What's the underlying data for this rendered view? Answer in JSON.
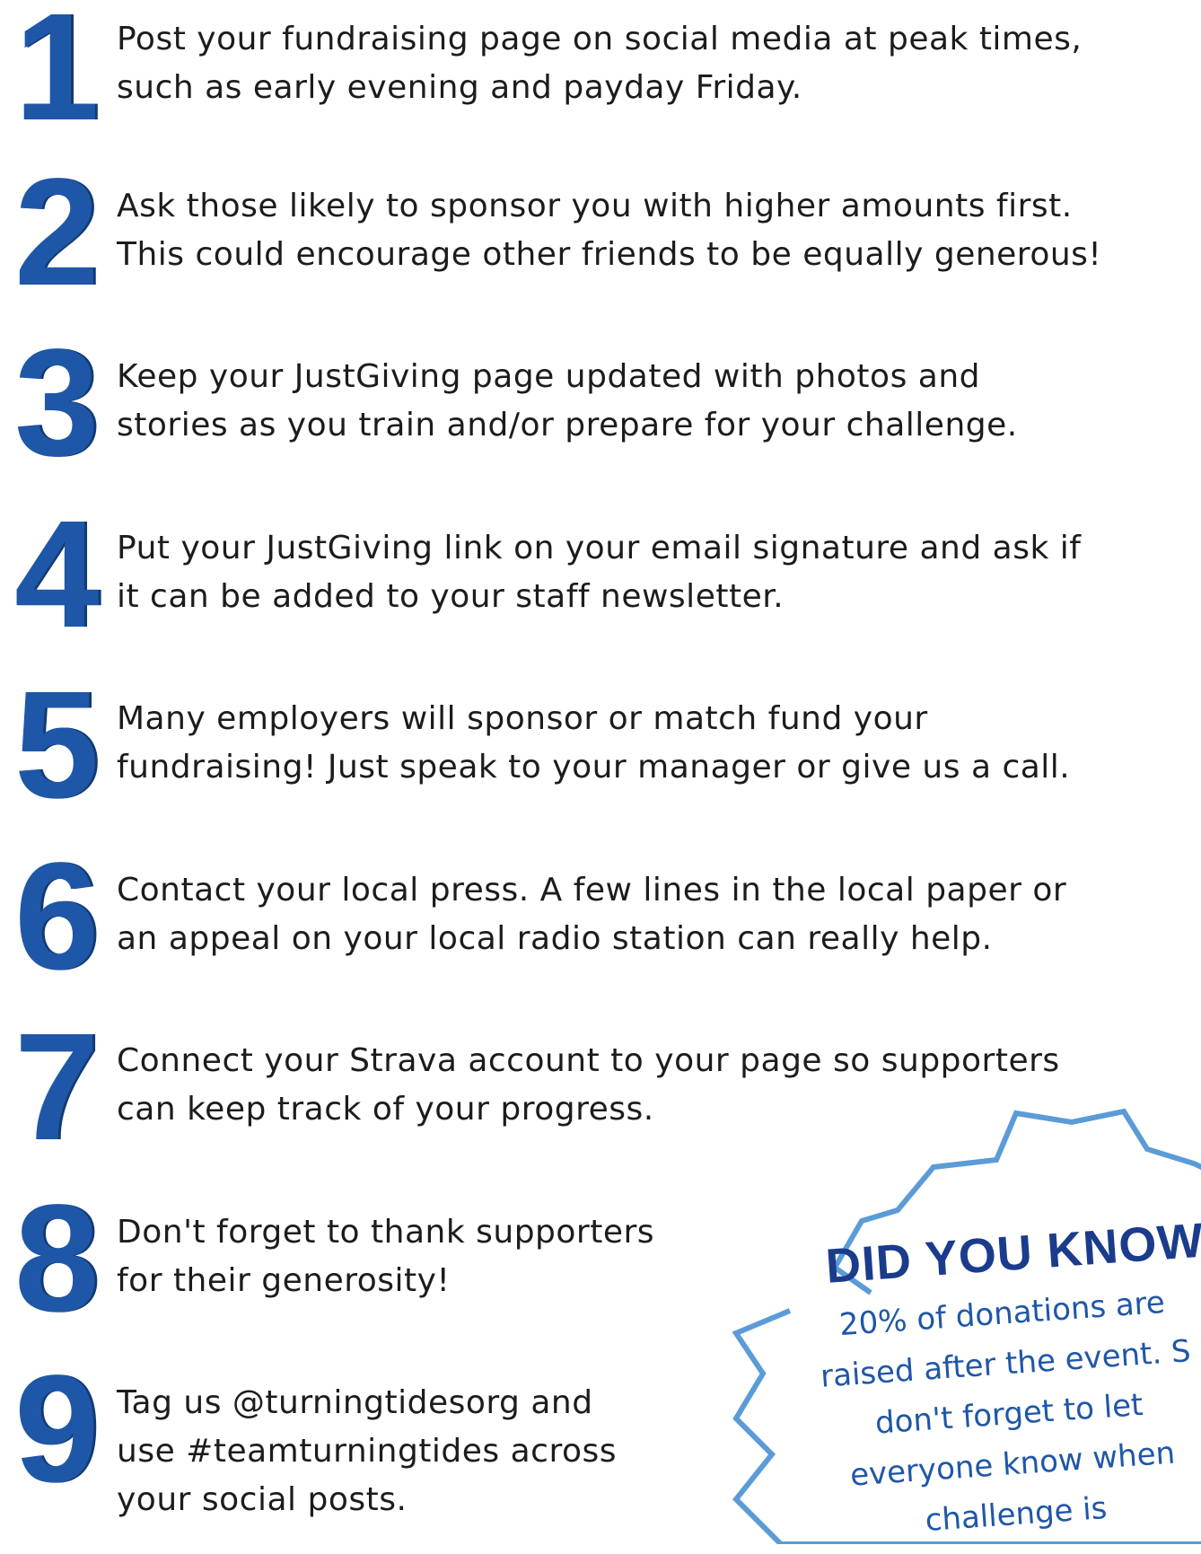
{
  "tips": [
    {
      "number": "1",
      "lines": [
        "Post your fundraising page on social media at peak times,",
        "such as early evening and payday Friday."
      ]
    },
    {
      "number": "2",
      "lines": [
        "Ask those likely to sponsor you with higher amounts first.",
        "This could encourage other friends to be equally generous!"
      ]
    },
    {
      "number": "3",
      "lines": [
        "Keep your JustGiving page updated with photos and",
        "stories as you train and/or prepare for your challenge."
      ]
    },
    {
      "number": "4",
      "lines": [
        "Put your JustGiving link on your email signature and ask if",
        "it can be added to your staff newsletter."
      ]
    },
    {
      "number": "5",
      "lines": [
        "Many employers will sponsor or match fund your",
        "fundraising! Just speak to your manager or give us a call."
      ]
    },
    {
      "number": "6",
      "lines": [
        "Contact your local press. A few lines in the local paper or",
        "an appeal on your local radio station can really help."
      ]
    },
    {
      "number": "7",
      "lines": [
        "Connect your Strava account to your page so supporters",
        "can keep track of your progress."
      ]
    },
    {
      "number": "8",
      "lines": [
        "Don't forget to thank supporters",
        "for their generosity!"
      ]
    },
    {
      "number": "9",
      "lines": [
        "Tag us @turningtidesorg and",
        "use #teamturningtides across",
        "your social posts."
      ]
    }
  ],
  "did_you_know": {
    "title": "DID YOU KNOW?",
    "lines": [
      "20% of donations are",
      "raised after the event. S",
      "don't forget to let",
      "everyone know when",
      "challenge is"
    ]
  },
  "colors": {
    "number_fill": "#1f57a8",
    "starburst_stroke": "#5b9bd8",
    "title": "#1b3c8c",
    "body": "#1f57a8"
  }
}
